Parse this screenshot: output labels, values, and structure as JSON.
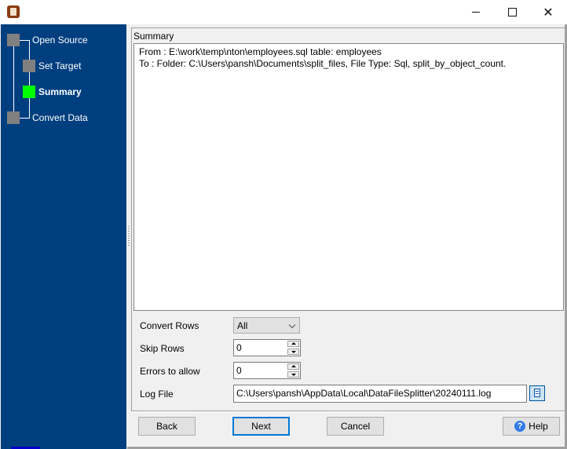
{
  "window": {
    "app_icon": "datafilesplitter-app-icon",
    "controls": {
      "minimize": "minimize-icon",
      "maximize": "maximize-icon",
      "close": "close-icon"
    }
  },
  "wizard": {
    "steps": [
      {
        "label": "Open Source",
        "state": "inactive"
      },
      {
        "label": "Set Target",
        "state": "inactive"
      },
      {
        "label": "Summary",
        "state": "active"
      },
      {
        "label": "Convert Data",
        "state": "inactive"
      }
    ],
    "colors": {
      "sidebar_bg": "#003f7f",
      "active_step": "#00ff00",
      "inactive_step": "#808080"
    }
  },
  "summary": {
    "title": "Summary",
    "lines": [
      "From : E:\\work\\temp\\nton\\employees.sql table: employees",
      "To : Folder: C:\\Users\\pansh\\Documents\\split_files, File Type: Sql, split_by_object_count."
    ]
  },
  "options": {
    "convert_rows": {
      "label": "Convert Rows",
      "value": "All"
    },
    "skip_rows": {
      "label": "Skip Rows",
      "value": "0"
    },
    "errors_to_allow": {
      "label": "Errors to allow",
      "value": "0"
    },
    "log_file": {
      "label": "Log File",
      "value": "C:\\Users\\pansh\\AppData\\Local\\DataFileSplitter\\20240111.log",
      "browse_icon": "browse-file-icon"
    }
  },
  "buttons": {
    "back": "Back",
    "next": "Next",
    "cancel": "Cancel",
    "help": "Help",
    "help_icon_glyph": "?"
  }
}
